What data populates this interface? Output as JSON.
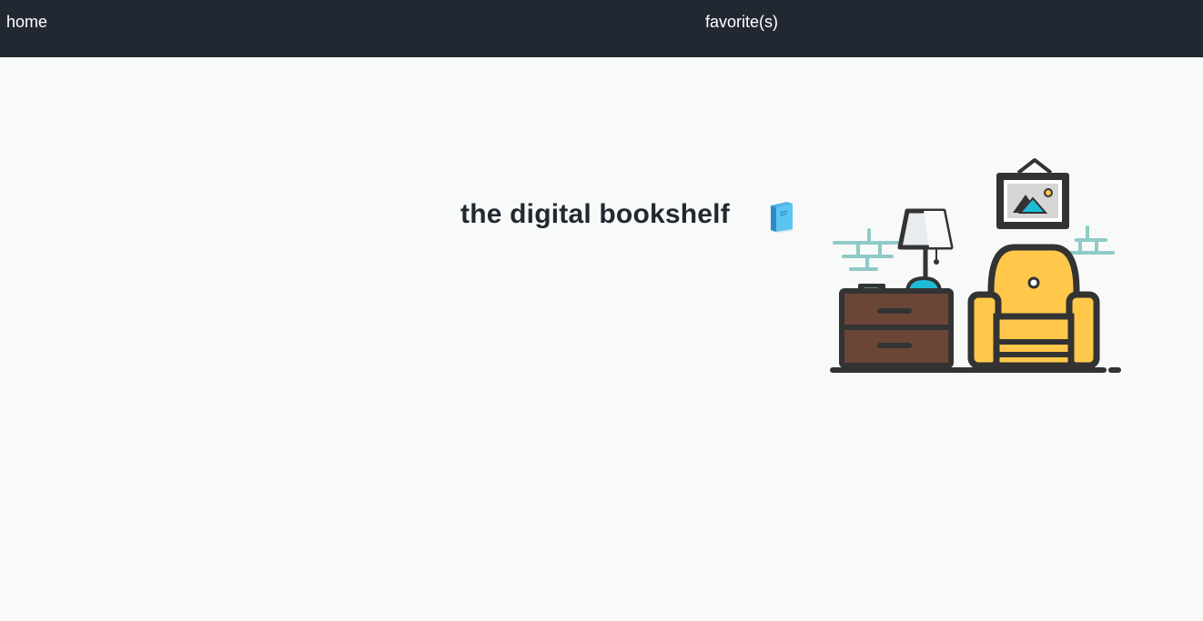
{
  "nav": {
    "home_label": "home",
    "favorites_label": "favorite(s)"
  },
  "hero": {
    "title": "the digital bookshelf",
    "title_icon": "blue-book-icon",
    "illustration": "living-room-illustration"
  },
  "colors": {
    "navbar_bg": "#222831",
    "page_bg": "#f8f9f9",
    "text_dark": "#222831",
    "armchair": "#ffc84a",
    "nightstand": "#6b4636",
    "lamp_base": "#1fbad6",
    "wall_bricks": "#8fcac7",
    "outline": "#333333"
  }
}
